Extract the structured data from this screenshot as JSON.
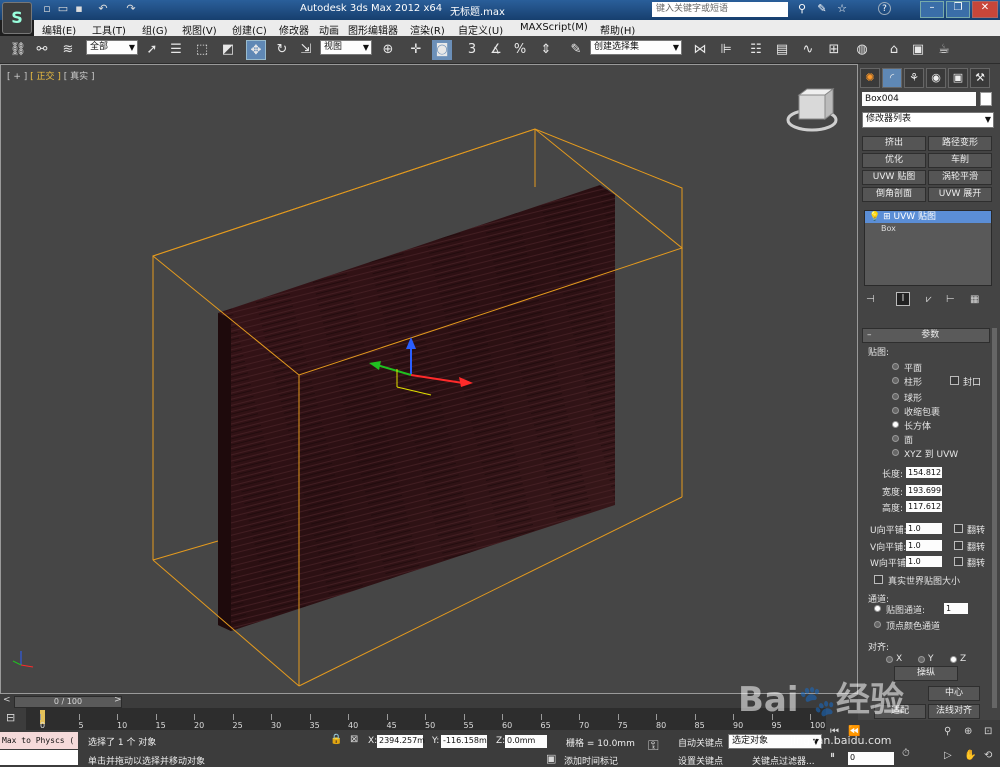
{
  "title": {
    "app": "Autodesk 3ds Max  2012 x64",
    "file": "无标题.max",
    "search_placeholder": "键入关键字或短语"
  },
  "menu": [
    "编辑(E)",
    "工具(T)",
    "组(G)",
    "视图(V)",
    "创建(C)",
    "修改器",
    "动画",
    "图形编辑器",
    "渲染(R)",
    "自定义(U)",
    "MAXScript(M)",
    "帮助(H)"
  ],
  "toolbar": {
    "selection_filter": "全部",
    "ref_coord": "视图",
    "named_selection": "创建选择集"
  },
  "viewport": {
    "label_plus": "[ + ]",
    "label_view": "[ 正交 ]",
    "label_shade": "[ 真实 ]"
  },
  "panel": {
    "object_name": "Box004",
    "modifier_list": "修改器列表",
    "buttons": [
      "挤出",
      "路径变形",
      "优化",
      "车削",
      "UVW 贴图",
      "涡轮平滑",
      "倒角剖面",
      "UVW 展开"
    ],
    "stack": [
      "UVW 贴图",
      "Box"
    ],
    "rollout_title": "参数",
    "mapping_label": "贴图:",
    "mapping_options": [
      "平面",
      "柱形",
      "球形",
      "收缩包裹",
      "长方体",
      "面",
      "XYZ 到 UVW"
    ],
    "cap_label": "封口",
    "selected_mapping": "长方体",
    "length_label": "长度:",
    "length": "154.812",
    "width_label": "宽度:",
    "width": "193.699",
    "height_label": "高度:",
    "height": "117.612",
    "u_tile_label": "U向平铺:",
    "u_tile": "1.0",
    "v_tile_label": "V向平铺:",
    "v_tile": "1.0",
    "w_tile_label": "W向平铺:",
    "w_tile": "1.0",
    "flip_label": "翻转",
    "real_world": "真实世界贴图大小",
    "channel_label": "通道:",
    "map_channel_label": "贴图通道:",
    "map_channel": "1",
    "vertex_color_label": "顶点颜色通道",
    "align_label": "对齐:",
    "align_axes": [
      "X",
      "Y",
      "Z"
    ],
    "manipulate": "操纵",
    "center": "中心",
    "fit": "适配",
    "normal_align": "法线对齐"
  },
  "timeline": {
    "frame": "0 / 100",
    "ticks": [
      "0",
      "5",
      "10",
      "15",
      "20",
      "25",
      "30",
      "35",
      "40",
      "45",
      "50",
      "55",
      "60",
      "65",
      "70",
      "75",
      "80",
      "85",
      "90",
      "95",
      "100"
    ]
  },
  "status": {
    "script_hint": "Max to Physcs (",
    "selected": "选择了 1 个 对象",
    "hint": "单击并拖动以选择并移动对象",
    "x_label": "X:",
    "x": "2394.257m",
    "y_label": "Y:",
    "y": "-116.158m",
    "z_label": "Z:",
    "z": "0.0mm",
    "grid": "栅格 = 10.0mm",
    "auto_key": "自动关键点",
    "set_key": "设置关键点",
    "key_mode": "选定对象",
    "key_filter": "关键点过滤器...",
    "add_time_tag": "添加时间标记",
    "frame_field": "0"
  },
  "watermark": "jingyan.baidu.com",
  "colors": {
    "titlebar": "#1f4f86",
    "bbox": "#e49a1e",
    "wood": "#3a1518"
  }
}
